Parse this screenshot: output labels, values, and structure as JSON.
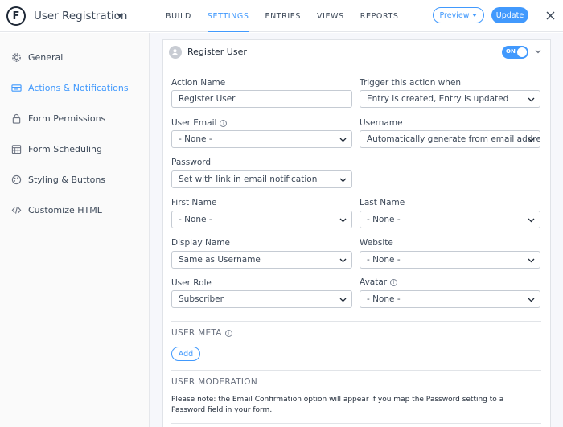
{
  "header": {
    "form_title": "User Registration",
    "tabs": [
      {
        "label": "BUILD",
        "active": false
      },
      {
        "label": "SETTINGS",
        "active": true
      },
      {
        "label": "ENTRIES",
        "active": false
      },
      {
        "label": "VIEWS",
        "active": false
      },
      {
        "label": "REPORTS",
        "active": false
      }
    ],
    "preview_label": "Preview",
    "update_label": "Update"
  },
  "sidebar": {
    "items": [
      {
        "label": "General",
        "icon": "gear-icon",
        "active": false
      },
      {
        "label": "Actions & Notifications",
        "icon": "megaphone-icon",
        "active": true
      },
      {
        "label": "Form Permissions",
        "icon": "lock-icon",
        "active": false
      },
      {
        "label": "Form Scheduling",
        "icon": "calendar-icon",
        "active": false
      },
      {
        "label": "Styling & Buttons",
        "icon": "palette-icon",
        "active": false
      },
      {
        "label": "Customize HTML",
        "icon": "code-icon",
        "active": false
      }
    ]
  },
  "action": {
    "title": "Register User",
    "toggle_label": "ON",
    "fields": {
      "action_name": {
        "label": "Action Name",
        "value": "Register User"
      },
      "trigger": {
        "label": "Trigger this action when",
        "value": "Entry is created, Entry is updated"
      },
      "user_email": {
        "label": "User Email",
        "value": "- None -"
      },
      "username": {
        "label": "Username",
        "value": "Automatically generate from email address"
      },
      "password": {
        "label": "Password",
        "value": "Set with link in email notification"
      },
      "first_name": {
        "label": "First Name",
        "value": "- None -"
      },
      "last_name": {
        "label": "Last Name",
        "value": "- None -"
      },
      "display_name": {
        "label": "Display Name",
        "value": "Same as Username"
      },
      "website": {
        "label": "Website",
        "value": "- None -"
      },
      "user_role": {
        "label": "User Role",
        "value": "Subscriber"
      },
      "avatar": {
        "label": "Avatar",
        "value": "- None -"
      }
    },
    "user_meta": {
      "title": "USER META",
      "add_label": "Add"
    },
    "user_moderation": {
      "title": "USER MODERATION",
      "note": "Please note: the Email Confirmation option will appear if you map the Password setting to a Password field in your form."
    }
  },
  "colors": {
    "accent": "#4199fd",
    "text": "#3c4858"
  }
}
